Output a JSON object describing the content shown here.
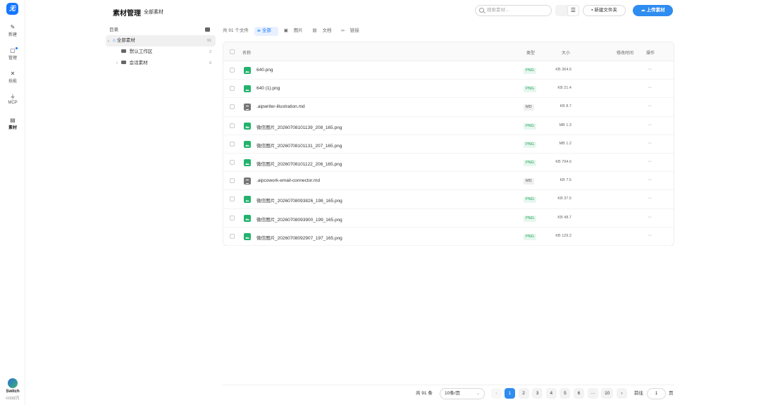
{
  "app": {
    "logo_glyph": "无",
    "title": "素材管理",
    "breadcrumb": "全部素材"
  },
  "rail": {
    "items": [
      {
        "label": "新建",
        "icon": "pen-icon"
      },
      {
        "label": "管理",
        "icon": "manage-icon"
      },
      {
        "label": "技能",
        "icon": "tools-icon"
      },
      {
        "label": "MCP",
        "icon": "plug-icon"
      },
      {
        "label": "素材",
        "icon": "assets-icon"
      }
    ],
    "switch_label": "Switch",
    "credits": "192万"
  },
  "toolbar": {
    "search_placeholder": "搜索素材...",
    "new_folder_label": "新建文件夹",
    "upload_label": "上传素材"
  },
  "tree": {
    "header": "目录",
    "root": {
      "label": "全部素材",
      "count": "91"
    },
    "children": [
      {
        "label": "默认工作区",
        "count": "2"
      },
      {
        "label": "会话素材",
        "count": "0"
      }
    ]
  },
  "filters": {
    "total": "共 91 个文件",
    "options": [
      "全部",
      "图片",
      "文档",
      "链接"
    ],
    "active": "全部"
  },
  "table": {
    "columns": {
      "name": "名称",
      "type": "类型",
      "size": "大小",
      "modified": "修改时间",
      "actions": "操作"
    },
    "rows": [
      {
        "name": "640.png",
        "type": "PNG",
        "size": "364.6 KB",
        "kind": "png"
      },
      {
        "name": "640 (1).png",
        "type": "PNG",
        "size": "21.4 KB",
        "kind": "png"
      },
      {
        "name": ".aipwriter-illustration.md",
        "type": "MD",
        "size": "8.7 KB",
        "kind": "md"
      },
      {
        "name": "微信图片_20260708101139_208_165.png",
        "type": "PNG",
        "size": "1.3 MB",
        "kind": "png"
      },
      {
        "name": "微信图片_20260708101131_207_165.png",
        "type": "PNG",
        "size": "1.2 MB",
        "kind": "png"
      },
      {
        "name": "微信图片_20260708101122_206_165.png",
        "type": "PNG",
        "size": "794.6 KB",
        "kind": "png"
      },
      {
        "name": ".aipcowork-email-connector.md",
        "type": "MD",
        "size": "7.5 KB",
        "kind": "md"
      },
      {
        "name": "微信图片_20260708093826_198_165.png",
        "type": "PNG",
        "size": "37.5 KB",
        "kind": "png"
      },
      {
        "name": "微信图片_20260708093900_199_165.png",
        "type": "PNG",
        "size": "48.7 KB",
        "kind": "png"
      },
      {
        "name": "微信图片_20260708092907_197_165.png",
        "type": "PNG",
        "size": "129.2 KB",
        "kind": "png"
      }
    ],
    "more_glyph": "···"
  },
  "pagination": {
    "total": "共 91 条",
    "per_page": "10条/页",
    "pages": [
      "1",
      "2",
      "3",
      "4",
      "5",
      "6",
      "···",
      "10"
    ],
    "current": "1",
    "goto_label": "前往",
    "goto_value": "1",
    "page_unit": "页",
    "prev": "‹",
    "next": "›"
  },
  "colors": {
    "accent": "#2f8cf0",
    "png_badge": "#23a35b",
    "folder": "#666666"
  }
}
